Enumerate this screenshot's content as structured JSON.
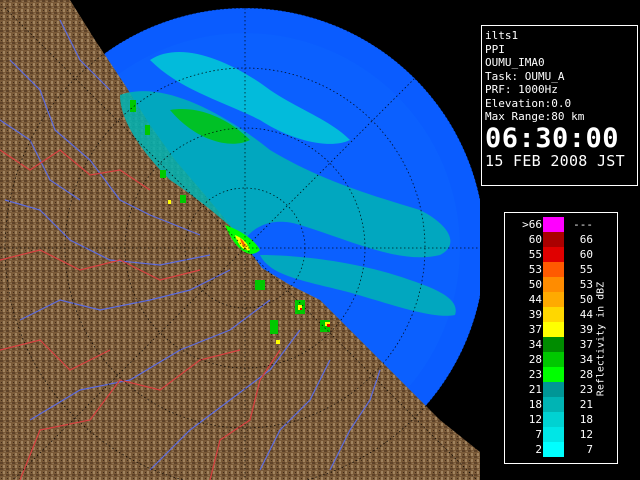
{
  "info_panel": {
    "radar_id": "ilts1",
    "scan_type": "PPI",
    "product": "OUMU_IMA0",
    "task": "Task: OUMU_A",
    "prf": "PRF: 1000Hz",
    "elevation": "Elevation:0.0",
    "max_range": "Max Range:80 km",
    "time": "06:30:00",
    "date": "15 FEB 2008 JST"
  },
  "legend": {
    "title": "Reflectivity in dBZ",
    "rows": [
      {
        "low": ">66",
        "high": "---",
        "color": "#ff00ff"
      },
      {
        "low": "60",
        "high": "66",
        "color": "#aa0000"
      },
      {
        "low": "55",
        "high": "60",
        "color": "#e00000"
      },
      {
        "low": "53",
        "high": "55",
        "color": "#ff5a00"
      },
      {
        "low": "50",
        "high": "53",
        "color": "#ff8c00"
      },
      {
        "low": "44",
        "high": "50",
        "color": "#ffaa00"
      },
      {
        "low": "39",
        "high": "44",
        "color": "#ffd700"
      },
      {
        "low": "37",
        "high": "39",
        "color": "#ffff00"
      },
      {
        "low": "34",
        "high": "37",
        "color": "#008c00"
      },
      {
        "low": "28",
        "high": "34",
        "color": "#00c800"
      },
      {
        "low": "23",
        "high": "28",
        "color": "#00ff00"
      },
      {
        "low": "21",
        "high": "23",
        "color": "#009696"
      },
      {
        "low": "18",
        "high": "21",
        "color": "#00b4b4"
      },
      {
        "low": "12",
        "high": "18",
        "color": "#00d2d2"
      },
      {
        "low": "7",
        "high": "12",
        "color": "#00e6e6"
      },
      {
        "low": "2",
        "high": "7",
        "color": "#00ffff"
      }
    ]
  },
  "colors": {
    "ocean": "#0a5cff",
    "out_of_range": "#000000",
    "land": "#7a5a38",
    "rivers": "#5a6ef0",
    "prefecture_borders": "#d84040",
    "range_rings": "#000000"
  }
}
